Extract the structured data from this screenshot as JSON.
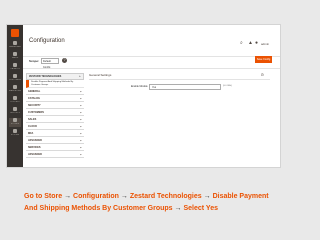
{
  "admin": {
    "nav": [
      {
        "label": "DASHBOARD"
      },
      {
        "label": "SALES"
      },
      {
        "label": "CATALOG"
      },
      {
        "label": "CUSTOMERS"
      },
      {
        "label": "MARKETING"
      },
      {
        "label": "CONTENT"
      },
      {
        "label": "REPORTS"
      },
      {
        "label": "STORES"
      },
      {
        "label": "SYSTEM"
      }
    ]
  },
  "header": {
    "title": "Configuration",
    "user": "admin"
  },
  "toolbar": {
    "scope_label": "Scope:",
    "scope_value": "Default Config",
    "scope_help": "?",
    "save_label": "Save Config"
  },
  "tree": {
    "section_title": "ZESTARD TECHNOLOGIES",
    "section_sub": "Disable Payment And Shipping Methods By Customer Groups",
    "items": [
      "GENERAL",
      "CATALOG",
      "SECURITY",
      "CUSTOMERS",
      "SALES",
      "CLOUD",
      "MFA",
      "ADVANCED",
      "SERVICES",
      "ADVANCED"
    ]
  },
  "panel": {
    "title": "General Settings",
    "collapse_icon": "⊙",
    "field_label": "Enable Module",
    "field_value": "Yes",
    "field_scope": "[GLOBAL]"
  },
  "caption": {
    "p1": "Go to Store",
    "arrow": "→",
    "p2": "Configuration",
    "p3": "Zestard Technologies",
    "p4": "Disable Payment And Shipping Methods By Customer Groups",
    "p5": "Select Yes"
  }
}
